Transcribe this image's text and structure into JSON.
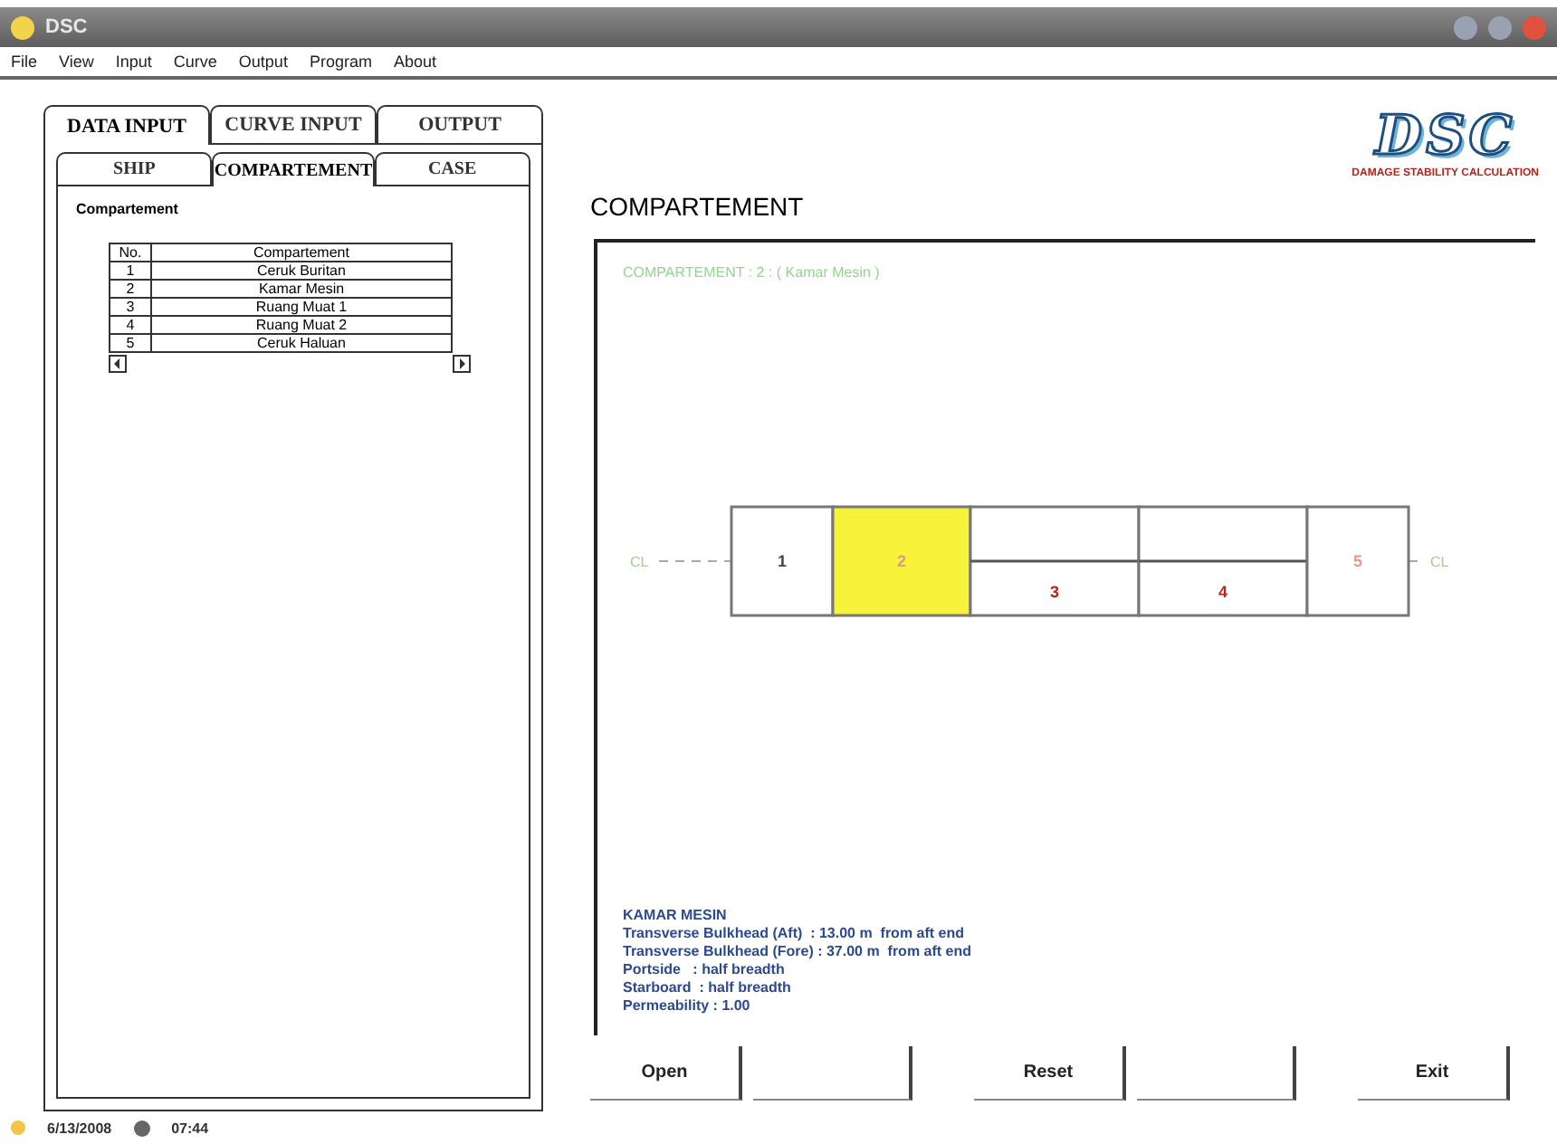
{
  "window": {
    "title": "DSC"
  },
  "menu": [
    "File",
    "View",
    "Input",
    "Curve",
    "Output",
    "Program",
    "About"
  ],
  "tabs": [
    {
      "label": "DATA INPUT",
      "selected": true
    },
    {
      "label": "CURVE INPUT",
      "selected": false
    },
    {
      "label": "OUTPUT",
      "selected": false
    }
  ],
  "subtabs": [
    {
      "label": "SHIP",
      "selected": false
    },
    {
      "label": "COMPARTEMENT",
      "selected": true
    },
    {
      "label": "CASE",
      "selected": false
    }
  ],
  "panel_label": "Compartement",
  "table": {
    "columns": [
      "No.",
      "Compartement"
    ],
    "rows": [
      [
        "1",
        "Ceruk Buritan"
      ],
      [
        "2",
        "Kamar Mesin"
      ],
      [
        "3",
        "Ruang Muat 1"
      ],
      [
        "4",
        "Ruang Muat 2"
      ],
      [
        "5",
        "Ceruk Haluan"
      ]
    ]
  },
  "logo": {
    "mark": "DSC",
    "subtitle": "DAMAGE STABILITY CALCULATION"
  },
  "heading": "COMPARTEMENT",
  "drawing": {
    "caption": "COMPARTEMENT : 2 : ( Kamar Mesin )",
    "centerline_labels": [
      "CL",
      "CL"
    ],
    "compartments": [
      {
        "label": "1",
        "kind": "end",
        "selected": false
      },
      {
        "label": "2",
        "kind": "end",
        "selected": true
      },
      {
        "label": "3",
        "kind": "split",
        "selected": false
      },
      {
        "label": "4",
        "kind": "split",
        "selected": false
      },
      {
        "label": "5",
        "kind": "end",
        "selected": false
      }
    ]
  },
  "info": {
    "title": "KAMAR MESIN",
    "lines": [
      "Transverse Bulkhead (Aft)  : 13.00 m  from aft end",
      "Transverse Bulkhead (Fore) : 37.00 m  from aft end",
      "Portside   : half breadth",
      "Starboard  : half breadth",
      "Permeability : 1.00"
    ]
  },
  "buttons": [
    {
      "label": "Open",
      "disabled": false
    },
    {
      "disabled": true
    },
    {
      "label": "Reset",
      "disabled": false
    },
    {
      "disabled": true
    },
    {
      "label": "Exit",
      "disabled": false
    }
  ],
  "status": {
    "date": "6/13/2008",
    "time": "07:44"
  }
}
